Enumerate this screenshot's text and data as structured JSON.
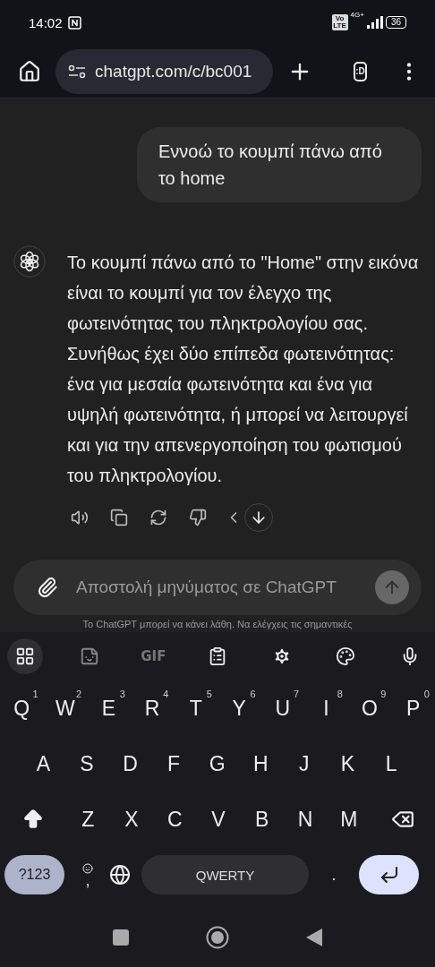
{
  "status_bar": {
    "time": "14:02",
    "volte": "Vo LTE",
    "network": "4G+",
    "battery": "36"
  },
  "browser": {
    "url": "chatgpt.com/c/bc001",
    "tabs_label": ":D"
  },
  "messages": [
    {
      "kind": "user",
      "text": "Εννοώ το κουμπί πάνω από το home"
    },
    {
      "kind": "assistant",
      "text": "Το κουμπί πάνω από το \"Home\" στην εικόνα είναι το κουμπί για τον έλεγχο της φωτεινότητας του πληκτρολογίου σας. Συνήθως έχει δύο επίπεδα φωτεινότητας: ένα για μεσαία φωτεινότητα και ένα για υψηλή φωτεινότητα, ή μπορεί να λειτουργεί και για την απενεργοποίηση του φωτισμού του πληκτρολογίου."
    }
  ],
  "composer": {
    "placeholder": "Αποστολή μηνύματος σε ChatGPT",
    "disclaimer": "Το ChatGPT μπορεί να κάνει λάθη. Να ελέγχεις τις σημαντικές"
  },
  "keyboard": {
    "toolbar_gif": "GIF",
    "rows": [
      [
        {
          "label": "Q",
          "hint": "1"
        },
        {
          "label": "W",
          "hint": "2"
        },
        {
          "label": "E",
          "hint": "3"
        },
        {
          "label": "R",
          "hint": "4"
        },
        {
          "label": "T",
          "hint": "5"
        },
        {
          "label": "Y",
          "hint": "6"
        },
        {
          "label": "U",
          "hint": "7"
        },
        {
          "label": "I",
          "hint": "8"
        },
        {
          "label": "O",
          "hint": "9"
        },
        {
          "label": "P",
          "hint": "0"
        }
      ],
      [
        {
          "label": "A"
        },
        {
          "label": "S"
        },
        {
          "label": "D"
        },
        {
          "label": "F"
        },
        {
          "label": "G"
        },
        {
          "label": "H"
        },
        {
          "label": "J"
        },
        {
          "label": "K"
        },
        {
          "label": "L"
        }
      ],
      [
        {
          "label": "Z"
        },
        {
          "label": "X"
        },
        {
          "label": "C"
        },
        {
          "label": "V"
        },
        {
          "label": "B"
        },
        {
          "label": "N"
        },
        {
          "label": "M"
        }
      ]
    ],
    "symbols_key": "?123",
    "comma": ",",
    "space": "QWERTY",
    "period": "."
  }
}
